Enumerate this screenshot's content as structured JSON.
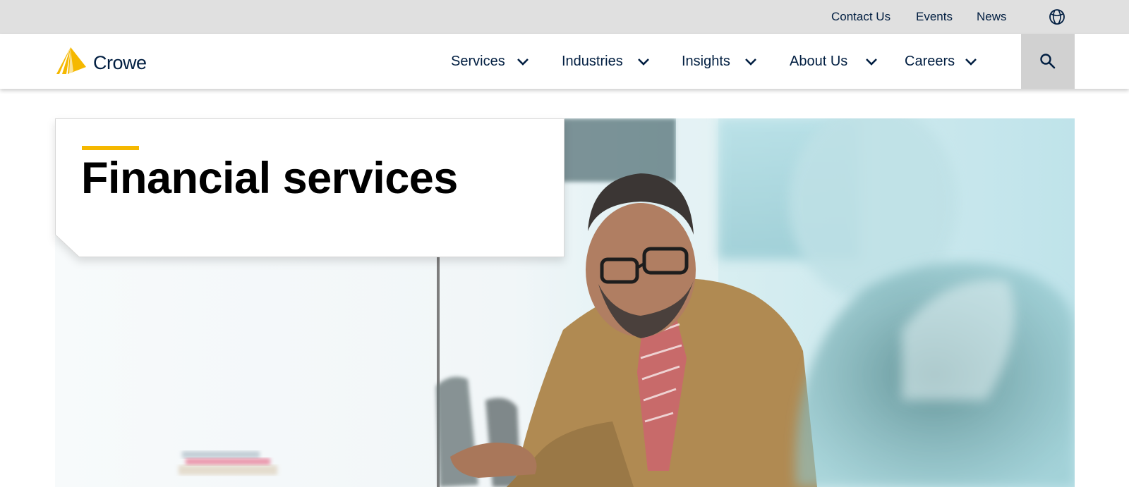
{
  "utility_nav": {
    "links": [
      {
        "label": "Contact Us"
      },
      {
        "label": "Events"
      },
      {
        "label": "News"
      }
    ],
    "language_icon": "globe-icon"
  },
  "brand": {
    "name": "Crowe",
    "logo_color": "#f5b800",
    "text_color": "#011e41"
  },
  "main_nav": {
    "items": [
      {
        "label": "Services",
        "icon": "chevron-down-icon"
      },
      {
        "label": "Industries",
        "icon": "chevron-down-icon"
      },
      {
        "label": "Insights",
        "icon": "chevron-down-icon"
      },
      {
        "label": "About Us",
        "icon": "chevron-down-icon"
      },
      {
        "label": "Careers",
        "icon": "chevron-down-icon"
      }
    ],
    "search_icon": "search-icon"
  },
  "hero": {
    "title": "Financial services",
    "accent_color": "#f5b800",
    "image_description_icon": "hero-photo"
  },
  "colors": {
    "navy": "#011e41",
    "utility_bg": "#e0e0e0",
    "search_bg": "#d1d1d1"
  }
}
